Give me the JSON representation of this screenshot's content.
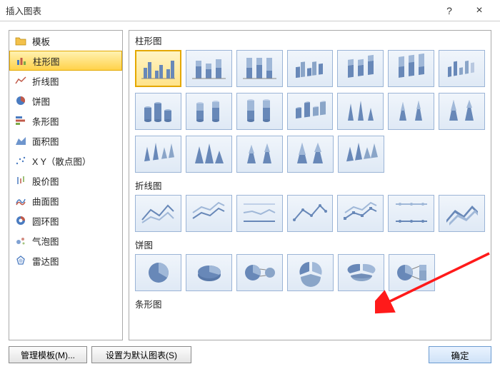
{
  "title": "插入图表",
  "titlebar": {
    "help_char": "?",
    "close_char": "×"
  },
  "sidebar": {
    "items": [
      {
        "label": "模板"
      },
      {
        "label": "柱形图",
        "selected": true
      },
      {
        "label": "折线图"
      },
      {
        "label": "饼图"
      },
      {
        "label": "条形图"
      },
      {
        "label": "面积图"
      },
      {
        "label": "X Y（散点图）"
      },
      {
        "label": "股价图"
      },
      {
        "label": "曲面图"
      },
      {
        "label": "圆环图"
      },
      {
        "label": "气泡图"
      },
      {
        "label": "雷达图"
      }
    ]
  },
  "gallery": {
    "sections": [
      {
        "label": "柱形图"
      },
      {
        "label": "折线图"
      },
      {
        "label": "饼图"
      },
      {
        "label": "条形图"
      }
    ]
  },
  "footer": {
    "manage_templates": "管理模板(M)...",
    "set_default": "设置为默认图表(S)",
    "ok": "确定"
  }
}
